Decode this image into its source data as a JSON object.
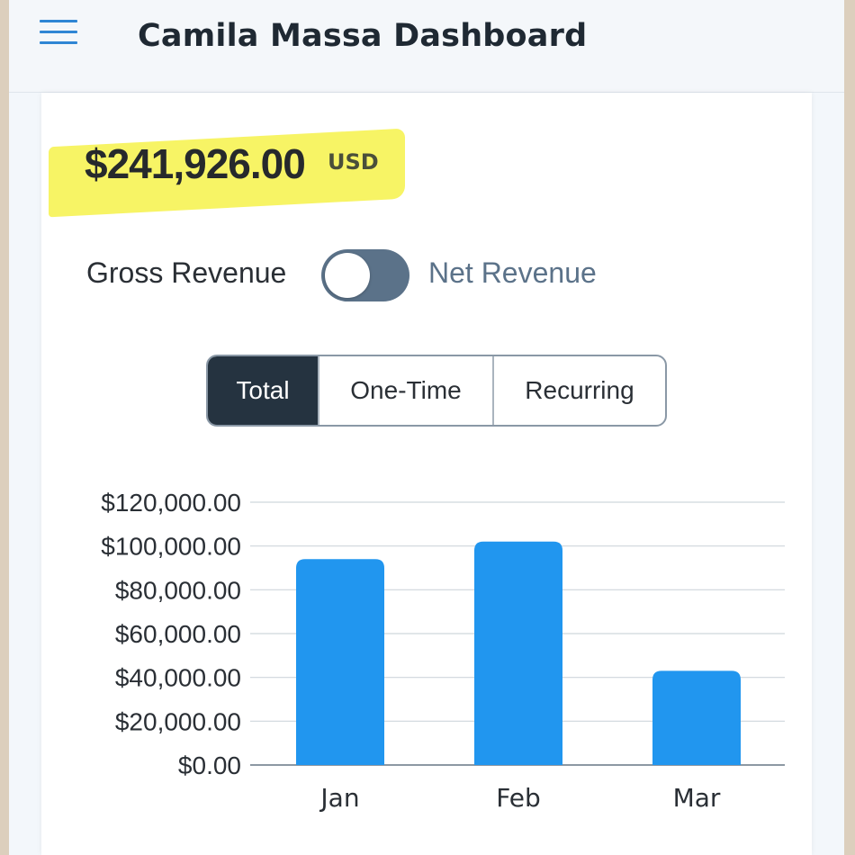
{
  "header": {
    "title": "Camila Massa Dashboard",
    "menu_icon": "hamburger-menu-icon"
  },
  "summary": {
    "amount": "$241,926.00",
    "currency": "USD",
    "highlight_color": "#f6f24a"
  },
  "revenue_toggle": {
    "left_label": "Gross Revenue",
    "right_label": "Net Revenue",
    "state": "gross",
    "track_color": "#5b7289"
  },
  "tabs": [
    {
      "label": "Total",
      "active": true
    },
    {
      "label": "One-Time",
      "active": false
    },
    {
      "label": "Recurring",
      "active": false
    }
  ],
  "chart_data": {
    "type": "bar",
    "categories": [
      "Jan",
      "Feb",
      "Mar"
    ],
    "values": [
      94000,
      102000,
      43000
    ],
    "ylim": [
      0,
      120000
    ],
    "yticks": [
      "$0.00",
      "$20,000.00",
      "$40,000.00",
      "$60,000.00",
      "$80,000.00",
      "$100,000.00",
      "$120,000.00"
    ],
    "bar_color": "#2196ef",
    "grid": true
  }
}
